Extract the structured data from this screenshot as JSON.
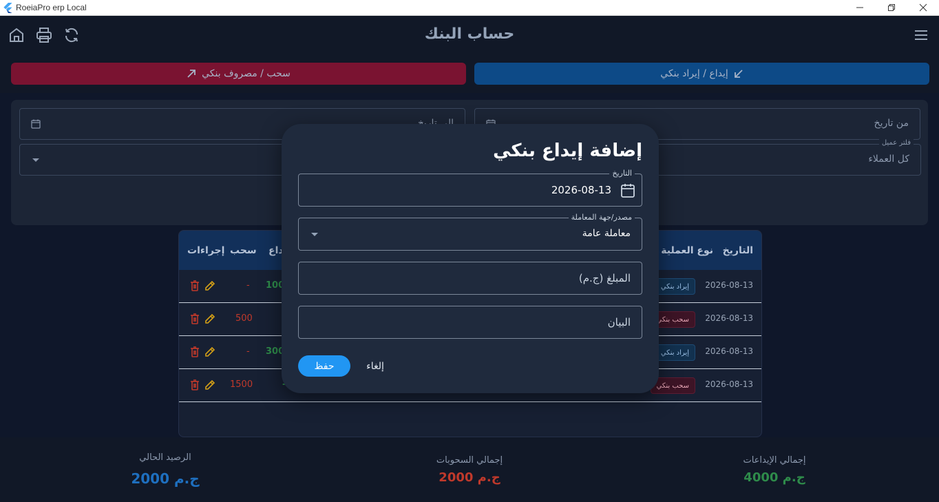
{
  "window": {
    "title": "RoeiaPro erp Local"
  },
  "appbar": {
    "title": "حساب البنك",
    "icons": [
      "home-icon",
      "print-icon",
      "refresh-icon",
      "menu-icon"
    ]
  },
  "actions": {
    "deposit_label": "إيداع / إيراد بنكي",
    "withdraw_label": "سحب / مصروف بنكي"
  },
  "filters": {
    "from_date_placeholder": "من تاريخ",
    "to_date_placeholder": "إلى تاريخ",
    "client_filter_label": "فلتر عميل",
    "client_filter_value": "كل العملاء"
  },
  "table": {
    "headers": {
      "date": "التاريخ",
      "type": "نوع العملية",
      "deposit": "إيداع",
      "withdraw": "سحب",
      "actions": "إجراءات"
    },
    "rows": [
      {
        "date": "2026-08-13",
        "type": "إيراد بنكي",
        "kind": "dep",
        "deposit": "1000",
        "withdraw": "-"
      },
      {
        "date": "2026-08-13",
        "type": "سحب بنكي",
        "kind": "wd",
        "deposit": "",
        "withdraw": "500"
      },
      {
        "date": "2026-08-13",
        "type": "إيراد بنكي",
        "kind": "dep",
        "deposit": "3000",
        "withdraw": "-"
      },
      {
        "date": "2026-08-13",
        "type": "سحب بنكي",
        "kind": "wd",
        "deposit": "-",
        "withdraw": "1500"
      }
    ]
  },
  "summary": {
    "total_deposits_label": "إجمالي الإيداعات",
    "total_deposits_value": "4000 ج.م",
    "total_withdrawals_label": "إجمالي السحوبات",
    "total_withdrawals_value": "2000 ج.م",
    "current_balance_label": "الرصيد الحالي",
    "current_balance_value": "2000 ج.م"
  },
  "dialog": {
    "title": "إضافة إيداع بنكي",
    "date_label": "التاريخ",
    "date_value": "2026-08-13",
    "source_label": "مصدر/جهة المعاملة",
    "source_value": "معاملة عامة",
    "amount_placeholder": "المبلغ (ج.م)",
    "description_placeholder": "البيان",
    "save_label": "حفظ",
    "cancel_label": "إلغاء"
  },
  "colors": {
    "deposit": "#0d4a87",
    "withdraw": "#7a1331",
    "positive": "#2e8b4a",
    "negative": "#c0392b",
    "balance": "#1e6fbf",
    "primary": "#2196f3"
  }
}
